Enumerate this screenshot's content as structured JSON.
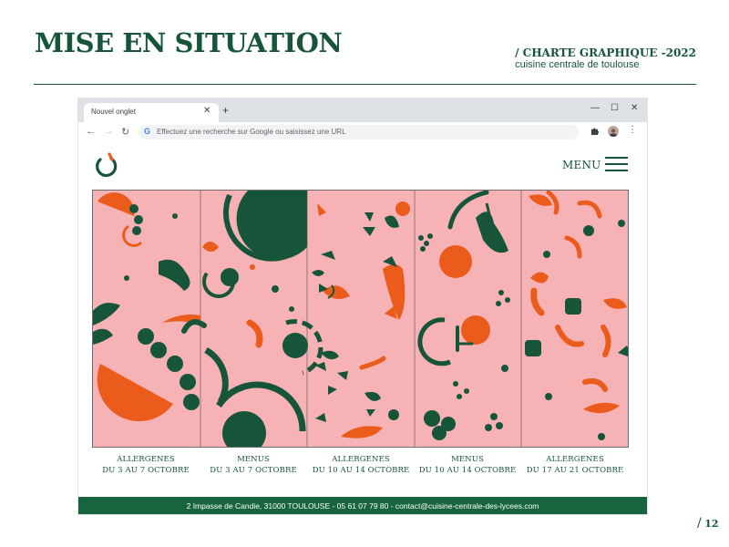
{
  "doc": {
    "title": "MISE EN SITUATION",
    "charte": "/ CHARTE GRAPHIQUE -2022",
    "subtitle": "cuisine centrale de toulouse",
    "page_number": "12",
    "page_slash": "/"
  },
  "browser": {
    "tab_title": "Nouvel onglet",
    "tab_close": "✕",
    "new_tab": "+",
    "minimize": "—",
    "maximize": "☐",
    "close": "✕",
    "back": "←",
    "forward": "→",
    "reload": "↻",
    "g_icon": "G",
    "address_placeholder": "Effectuez une recherche sur Google ou saisissez une URL",
    "kebab": "⋮"
  },
  "site": {
    "menu_label": "MENU",
    "footer": "2 Impasse de Candie, 31000 TOULOUSE - 05 61 07 79 80 - contact@cuisine-centrale-des-lycees.com",
    "colors": {
      "green": "#16553a",
      "orange": "#ea5b1c",
      "pink": "#f6b2b4"
    },
    "cards": [
      {
        "line1": "ALLERGENES",
        "line2": "DU 3 AU 7 OCTOBRE"
      },
      {
        "line1": "MENUS",
        "line2": "DU 3 AU 7 OCTOBRE"
      },
      {
        "line1": "ALLERGENES",
        "line2": "DU 10 AU 14 OCTOBRE"
      },
      {
        "line1": "MENUS",
        "line2": "DU 10 AU 14 OCTOBRE"
      },
      {
        "line1": "ALLERGENES",
        "line2": "DU 17 AU 21 OCTOBRE"
      }
    ]
  }
}
